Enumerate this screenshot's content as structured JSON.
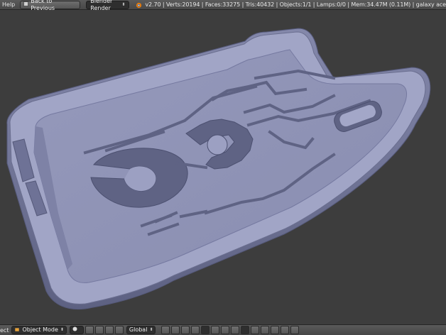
{
  "top_bar": {
    "help_menu": "Help",
    "back_button": "Back to Previous",
    "render_engine": "Blender Render",
    "stats": "v2.70 | Verts:20194 | Faces:33275 | Tris:40432 | Objects:1/1 | Lamps:0/0 | Mem:34.47M (0.11M) | galaxy ace"
  },
  "bottom_bar": {
    "menu_label": "ect",
    "mode": "Object Mode",
    "orientation": "Global"
  },
  "colors": {
    "viewport_bg": "#3d3d3d",
    "mesh_color": "#8f93b4",
    "header_bg": "#525252"
  }
}
